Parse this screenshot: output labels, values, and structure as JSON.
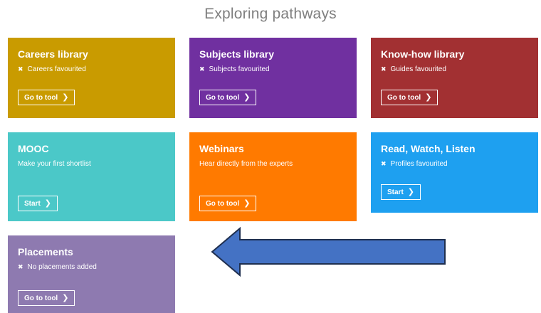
{
  "page": {
    "title": "Exploring pathways"
  },
  "tiles": [
    {
      "title": "Careers library",
      "subtitle": "Careers favourited",
      "has_x": true,
      "button": "Go to tool",
      "color": "#c99b00"
    },
    {
      "title": "Subjects library",
      "subtitle": "Subjects favourited",
      "has_x": true,
      "button": "Go to tool",
      "color": "#7030a0"
    },
    {
      "title": "Know-how library",
      "subtitle": "Guides favourited",
      "has_x": true,
      "button": "Go to tool",
      "color": "#a23032"
    },
    {
      "title": "MOOC",
      "subtitle": "Make your first shortlist",
      "has_x": false,
      "button": "Start",
      "color": "#4bc8c8"
    },
    {
      "title": "Webinars",
      "subtitle": "Hear directly from the experts",
      "has_x": false,
      "button": "Go to tool",
      "color": "#ff7a00"
    },
    {
      "title": "Read, Watch, Listen",
      "subtitle": "Profiles favourited",
      "has_x": true,
      "button": "Start",
      "color": "#1ea0f0"
    },
    {
      "title": "Placements",
      "subtitle": "No placements added",
      "has_x": true,
      "button": "Go to tool",
      "color": "#8e7ab0"
    }
  ],
  "icons": {
    "status": "close-icon",
    "button": "chevron-right-icon"
  },
  "annotation": {
    "shape": "arrow-left",
    "fill": "#4472c4",
    "stroke": "#1f2f4f"
  }
}
